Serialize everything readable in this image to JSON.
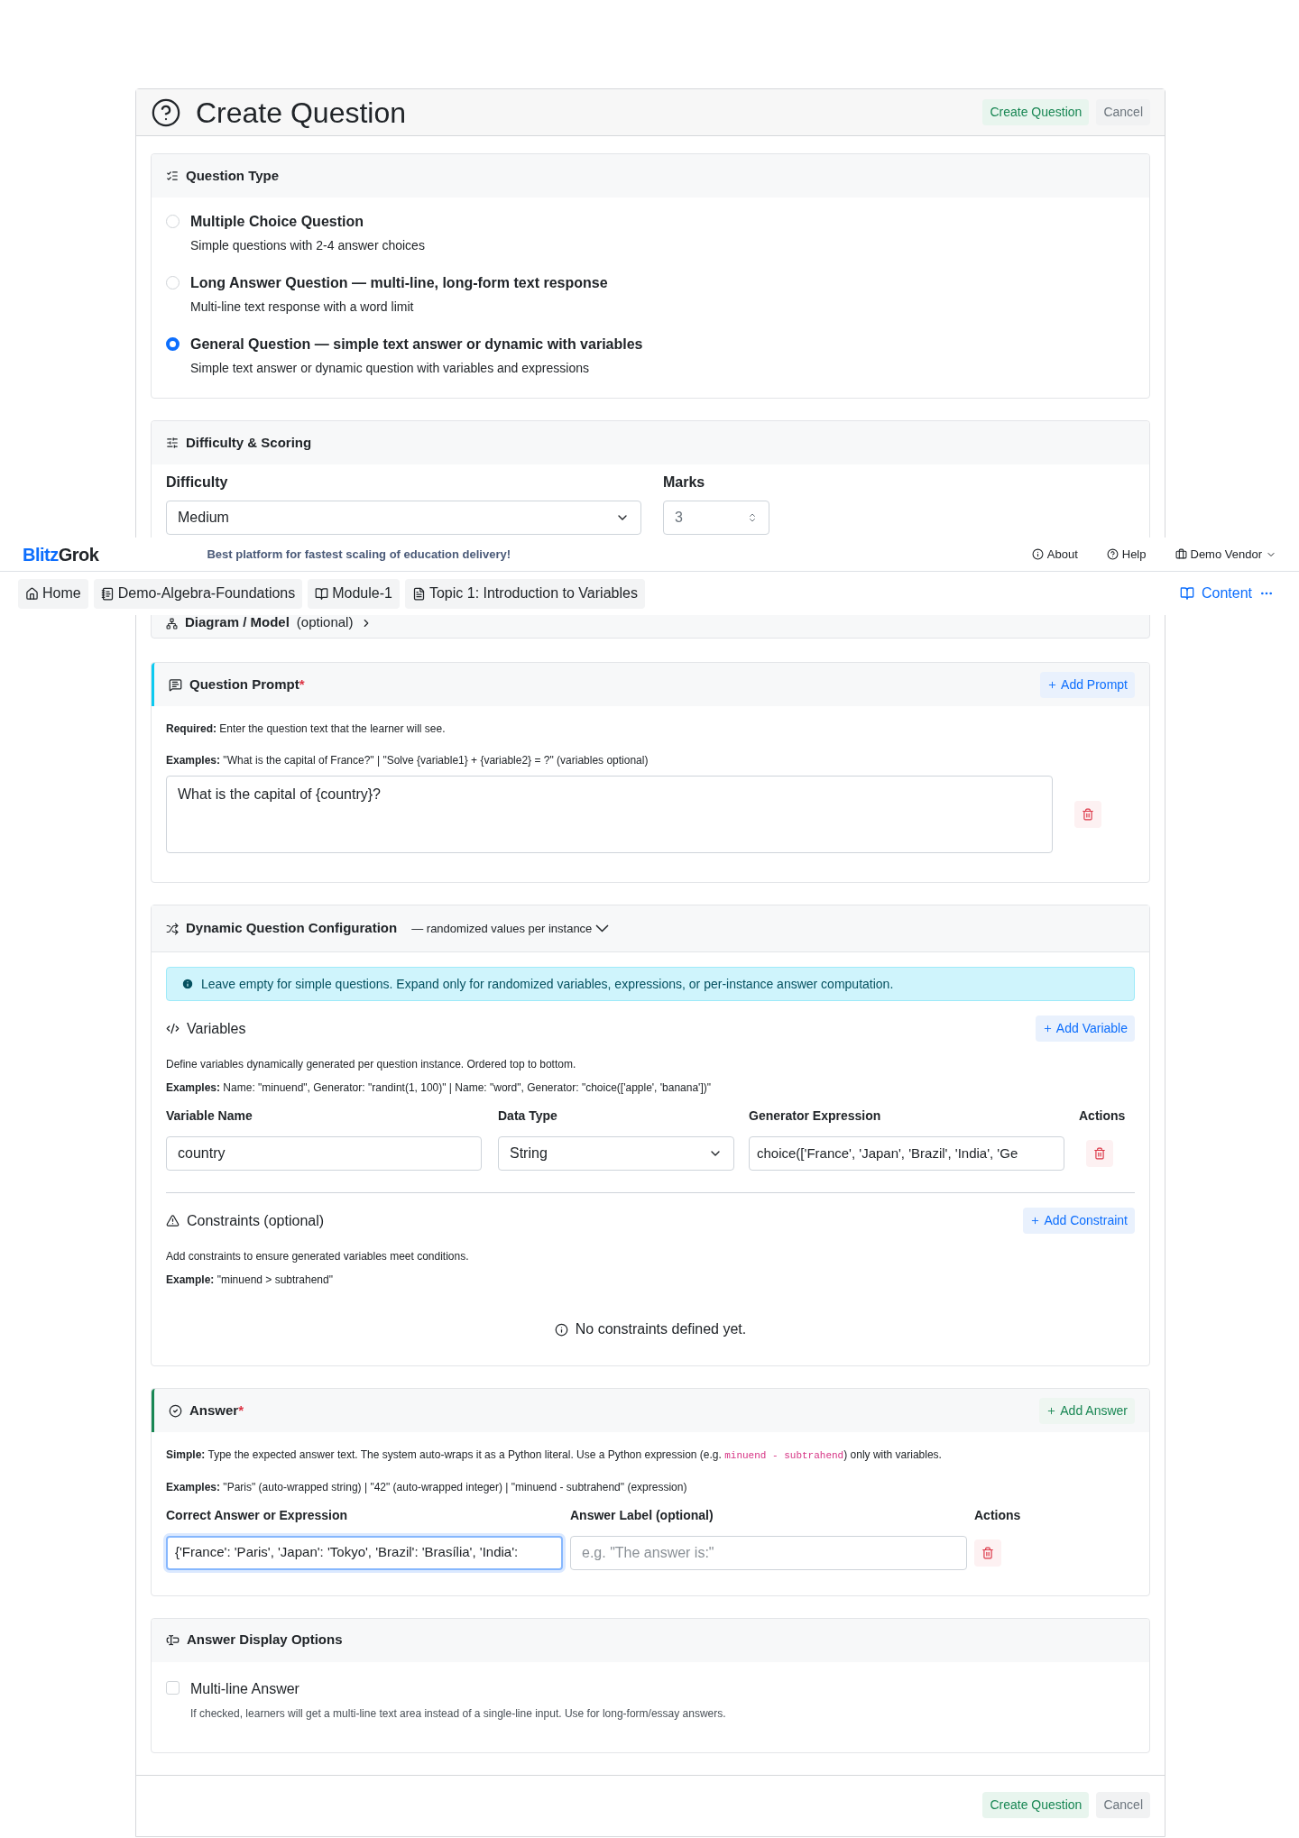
{
  "header": {
    "title": "Create Question",
    "buttons": [
      {
        "label": "Create Question",
        "kind": "primary"
      },
      {
        "label": "Cancel",
        "kind": "secondary"
      }
    ]
  },
  "question_type": {
    "title": "Question Type",
    "options": [
      {
        "label": "Multiple Choice Question",
        "description": "Simple questions with 2-4 answer choices",
        "selected": false
      },
      {
        "label": "Long Answer Question — multi-line, long-form text response",
        "description": "Multi-line text response with a word limit",
        "selected": false
      },
      {
        "label": "General Question — simple text answer or dynamic with variables",
        "description": "Simple text answer or dynamic question with variables and expressions",
        "selected": true
      }
    ]
  },
  "difficulty_scoring": {
    "title": "Difficulty & Scoring",
    "difficulty": {
      "label": "Difficulty",
      "value": "Medium"
    },
    "marks": {
      "label": "Marks",
      "value": "3"
    }
  },
  "diagram": {
    "title": "Diagram / Model",
    "suffix": "(optional)"
  },
  "navbar": {
    "brand": [
      {
        "text": "Blitz",
        "kind": "accent"
      },
      {
        "text": "Grok",
        "kind": "plain"
      }
    ],
    "tagline": "Best platform for fastest scaling of education delivery!",
    "links": [
      "About",
      "Help"
    ],
    "user": "Demo Vendor",
    "breadcrumbs": [
      "Home",
      "Demo-Algebra-Foundations",
      "Module-1",
      "Topic 1: Introduction to Variables"
    ],
    "content_link": "Content"
  },
  "question_prompt": {
    "title": "Question Prompt",
    "required_mark": "*",
    "add_button": "Add Prompt",
    "notes": [
      "**Required:** Enter the question text that the learner will see.",
      "**Examples:** \"What is the capital of France?\" | \"Solve {variable1} + {variable2} = ?\" (variables optional)"
    ],
    "value": "What is the capital of {country}?"
  },
  "dynamic": {
    "title": "Dynamic Question Configuration",
    "subtitle": "— randomized values per instance",
    "info": "Leave empty for simple questions. Expand only for randomized variables, expressions, or per-instance answer computation.",
    "variables": {
      "title": "Variables",
      "add_button": "Add Variable",
      "notes": [
        "Define variables dynamically generated per question instance. Ordered top to bottom.",
        "**Examples:** Name: \"minuend\", Generator: \"randint(1, 100)\" | Name: \"word\", Generator: \"choice(['apple', 'banana'])\""
      ],
      "columns": [
        "Variable Name",
        "Data Type",
        "Generator Expression",
        "Actions"
      ],
      "rows": [
        {
          "name": "country",
          "type": "String",
          "generator": "choice(['France', 'Japan', 'Brazil', 'India', 'Ge"
        }
      ]
    },
    "constraints": {
      "title": "Constraints (optional)",
      "add_button": "Add Constraint",
      "notes": [
        "Add constraints to ensure generated variables meet conditions.",
        "**Example:** \"minuend > subtrahend\""
      ],
      "empty": "No constraints defined yet."
    }
  },
  "answer": {
    "title": "Answer",
    "required_mark": "*",
    "add_button": "Add Answer",
    "simple_note": {
      "before": "**Simple:** Type the expected answer text. The system auto-wraps it as a Python literal. Use a Python expression (e.g. ",
      "code": "minuend - subtrahend",
      "after": ") only with variables."
    },
    "examples_note": "**Examples:** \"Paris\" (auto-wrapped string) | \"42\" (auto-wrapped integer) | \"minuend - subtrahend\" (expression)",
    "columns": [
      "Correct Answer or Expression",
      "Answer Label (optional)",
      "Actions"
    ],
    "rows": [
      {
        "value": "{'France': 'Paris', 'Japan': 'Tokyo', 'Brazil': 'Brasília', 'India':",
        "label_placeholder": "e.g. \"The answer is:\"",
        "focused": true
      }
    ]
  },
  "display_options": {
    "title": "Answer Display Options",
    "options": [
      {
        "label": "Multi-line Answer",
        "description": "If checked, learners will get a multi-line text area instead of a single-line input. Use for long-form/essay answers.",
        "checked": false
      }
    ]
  },
  "footer": {
    "buttons": [
      {
        "label": "Create Question",
        "kind": "primary"
      },
      {
        "label": "Cancel",
        "kind": "secondary"
      }
    ]
  }
}
